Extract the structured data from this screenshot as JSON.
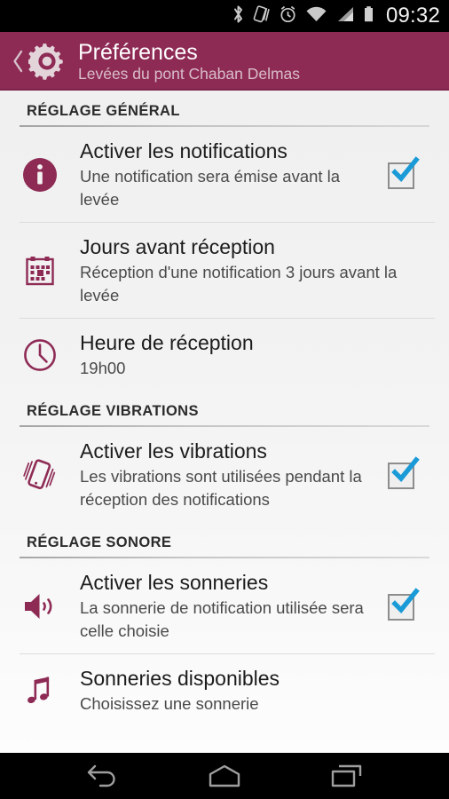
{
  "statusbar": {
    "time": "09:32",
    "icons": [
      "bluetooth-icon",
      "vibrate-icon",
      "alarm-icon",
      "wifi-icon",
      "cellular-signal-icon",
      "battery-icon"
    ]
  },
  "actionbar": {
    "back_label": "‹",
    "icon": "gear-icon",
    "title": "Préférences",
    "subtitle": "Levées du pont Chaban Delmas",
    "color": "#8e2b55"
  },
  "accent_color": "#8e2b55",
  "check_color": "#1a9bd7",
  "sections": [
    {
      "header": "RÉGLAGE GÉNÉRAL",
      "rows": [
        {
          "icon": "info-icon",
          "title": "Activer les notifications",
          "summary": "Une notification sera émise avant la levée",
          "widget": "checkbox",
          "checked": true
        },
        {
          "icon": "calendar-icon",
          "title": "Jours avant réception",
          "summary": "Réception d'une notification 3 jours avant la levée",
          "widget": "none",
          "checked": false
        },
        {
          "icon": "clock-icon",
          "title": "Heure de réception",
          "summary": "19h00",
          "widget": "none",
          "checked": false
        }
      ]
    },
    {
      "header": "RÉGLAGE VIBRATIONS",
      "rows": [
        {
          "icon": "vibration-phone-icon",
          "title": "Activer les vibrations",
          "summary": "Les vibrations sont utilisées pendant la réception des notifications",
          "widget": "checkbox",
          "checked": true
        }
      ]
    },
    {
      "header": "RÉGLAGE SONORE",
      "rows": [
        {
          "icon": "speaker-icon",
          "title": "Activer les sonneries",
          "summary": "La sonnerie de notification utilisée sera celle choisie",
          "widget": "checkbox",
          "checked": true
        },
        {
          "icon": "music-note-icon",
          "title": "Sonneries disponibles",
          "summary": "Choisissez une sonnerie",
          "widget": "none",
          "checked": false
        }
      ]
    }
  ],
  "navbar": {
    "buttons": [
      {
        "name": "back-nav-button",
        "icon": "back-arrow-icon"
      },
      {
        "name": "home-nav-button",
        "icon": "home-icon"
      },
      {
        "name": "recents-nav-button",
        "icon": "recent-apps-icon"
      }
    ]
  }
}
